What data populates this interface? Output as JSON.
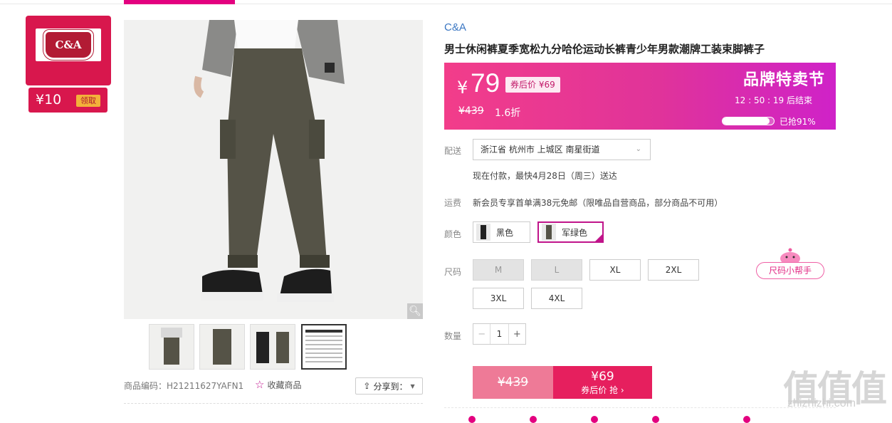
{
  "brand_coupon": {
    "logo_text": "C&A",
    "amount": "¥10",
    "claim_label": "领取"
  },
  "product": {
    "brand": "C&A",
    "title": "男士休闲裤夏季宽松九分哈伦运动长裤青少年男款潮牌工装束脚裤子",
    "code_label": "商品编码：H21211627YAFN1",
    "favorite_label": "收藏商品",
    "share_label": "分享到："
  },
  "price": {
    "currency": "¥",
    "value": "79",
    "after_coupon": "券后价 ¥69",
    "original": "¥439",
    "discount": "1.6折",
    "festival": "品牌特卖节",
    "countdown": "12 : 50 : 19  后结束",
    "snapped": "已抢91%",
    "snapped_fraction": 0.91
  },
  "delivery": {
    "label": "配送",
    "address": "浙江省 杭州市 上城区 南星街道",
    "eta": "现在付款，最快4月28日（周三）送达"
  },
  "shipping": {
    "label": "运费",
    "text": "新会员专享首单满38元免邮（限唯品自营商品，部分商品不可用）"
  },
  "color": {
    "label": "颜色",
    "options": [
      {
        "name": "黑色",
        "selected": false
      },
      {
        "name": "军绿色",
        "selected": true
      }
    ]
  },
  "size": {
    "label": "尺码",
    "options": [
      {
        "name": "M",
        "available": false
      },
      {
        "name": "L",
        "available": false
      },
      {
        "name": "XL",
        "available": true
      },
      {
        "name": "2XL",
        "available": true
      },
      {
        "name": "3XL",
        "available": true
      },
      {
        "name": "4XL",
        "available": true
      }
    ],
    "helper": "尺码小帮手"
  },
  "quantity": {
    "label": "数量",
    "minus": "−",
    "value": "1",
    "plus": "+"
  },
  "buy": {
    "original": "¥439",
    "price": "¥69",
    "action": "券后价 抢 ›"
  },
  "watermark": {
    "chars": "值值值",
    "url": "zhizhizhi.com"
  },
  "colors": {
    "accent": "#e3007f",
    "buy": "#e61f5e",
    "brand_red": "#d8174d"
  }
}
